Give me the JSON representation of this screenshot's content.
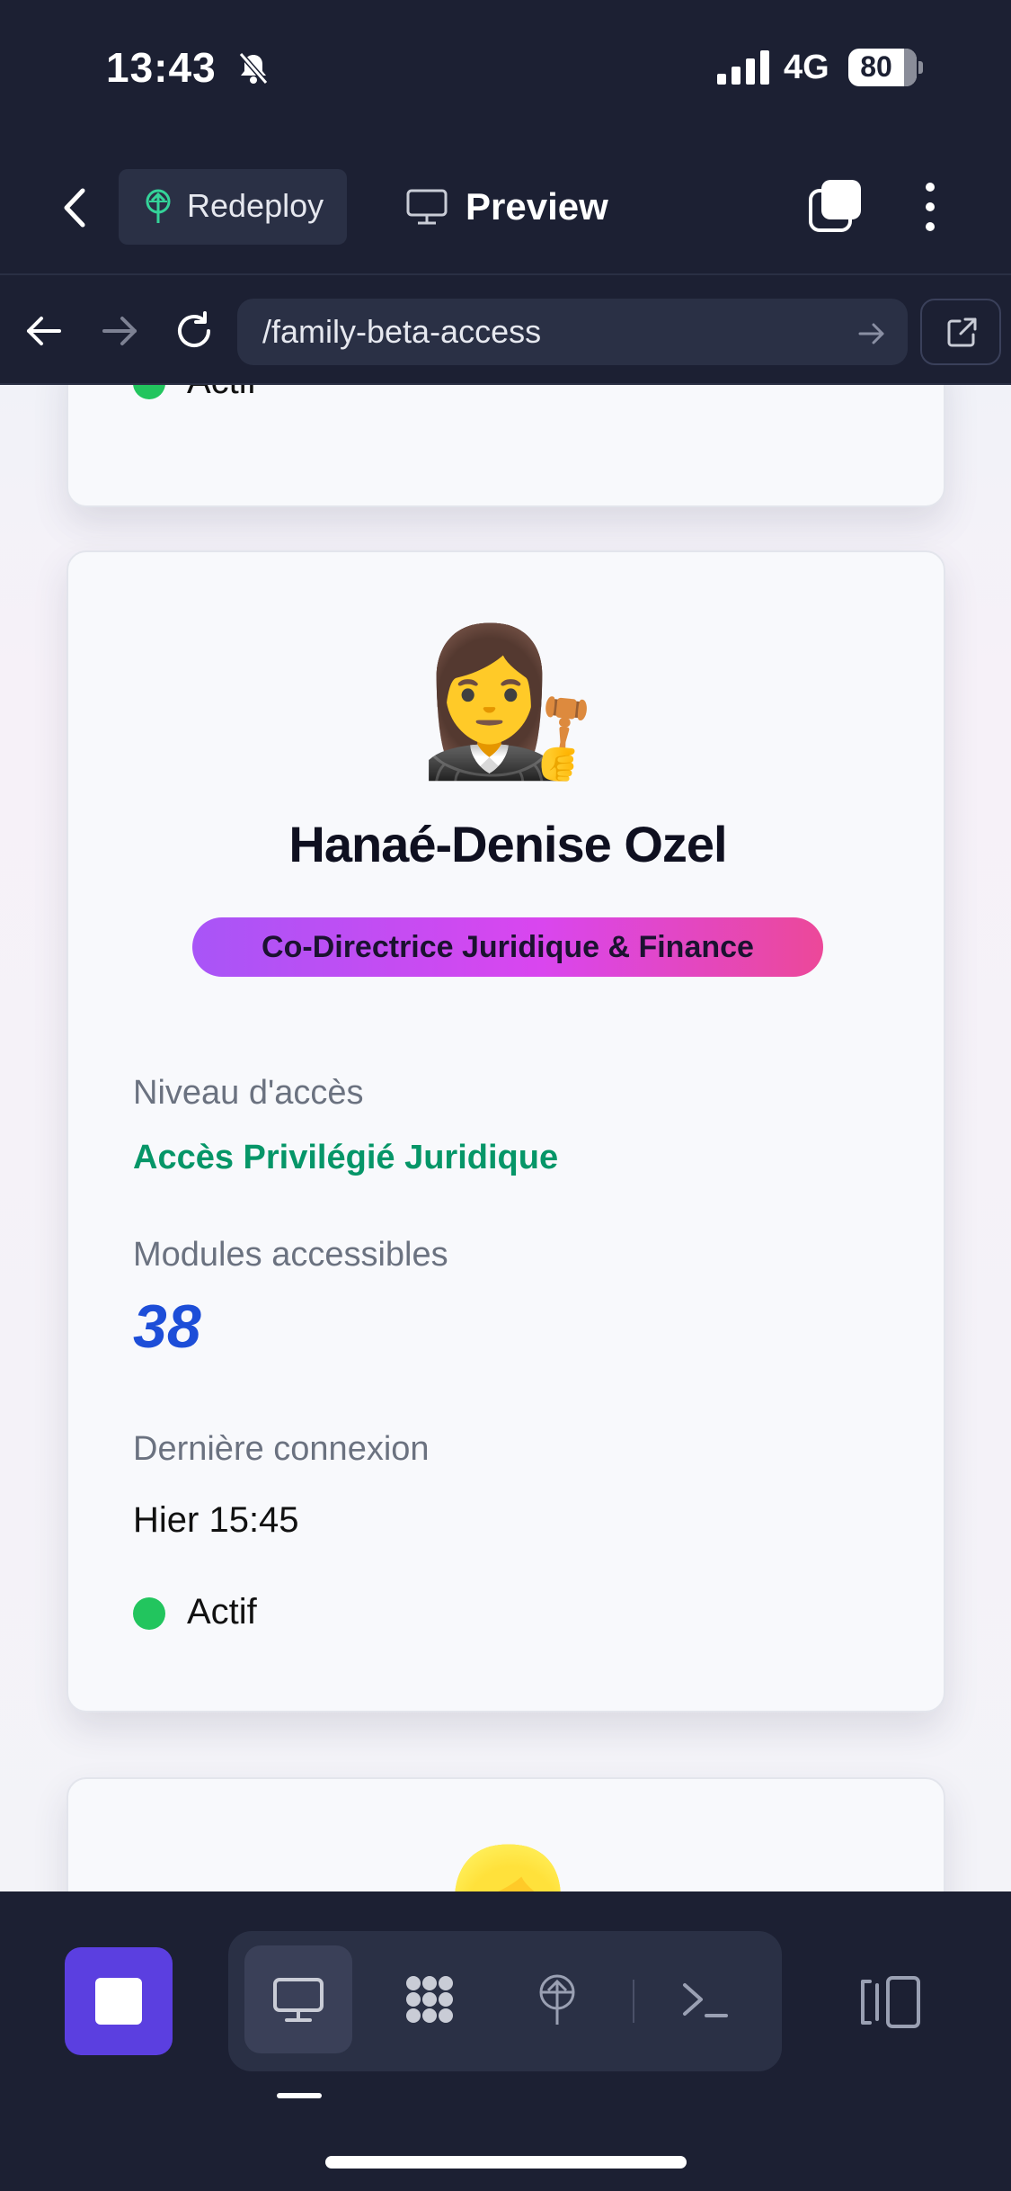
{
  "status_bar": {
    "time": "13:43",
    "network": "4G",
    "battery": "80",
    "icons": [
      "bell-slash-icon",
      "signal-icon"
    ]
  },
  "toolbar": {
    "redeploy_label": "Redeploy",
    "preview_label": "Preview",
    "icons": [
      "back-chevron-icon",
      "redeploy-icon",
      "monitor-icon",
      "tabs-icon",
      "more-icon"
    ]
  },
  "urlbar": {
    "url": "/family-beta-access",
    "icons": [
      "nav-back-icon",
      "nav-forward-icon",
      "reload-icon",
      "url-go-icon",
      "external-link-icon"
    ]
  },
  "previous_card": {
    "status": "Actif",
    "status_color": "#22c55e"
  },
  "profile": {
    "avatar": "👩‍⚖️",
    "name": "Hanaé-Denise Ozel",
    "role": "Co-Directrice Juridique & Finance",
    "access_label": "Niveau d'accès",
    "access_value": "Accès Privilégié Juridique",
    "modules_label": "Modules accessibles",
    "modules_value": "38",
    "login_label": "Dernière connexion",
    "login_value": "Hier 15:45",
    "status": "Actif",
    "colors": {
      "access": "#069668",
      "modules": "#1d4ed8",
      "status": "#22c55e",
      "badge_start": "#a855f7",
      "badge_end": "#ec4899"
    }
  },
  "next_card": {
    "avatar": "👱‍♀️"
  },
  "bottom_bar": {
    "accent": "#5b3fe0",
    "icons": [
      "stop-icon",
      "desktop-icon",
      "workflow-icon",
      "deploy-icon",
      "terminal-icon",
      "layout-toggle-icon"
    ]
  }
}
